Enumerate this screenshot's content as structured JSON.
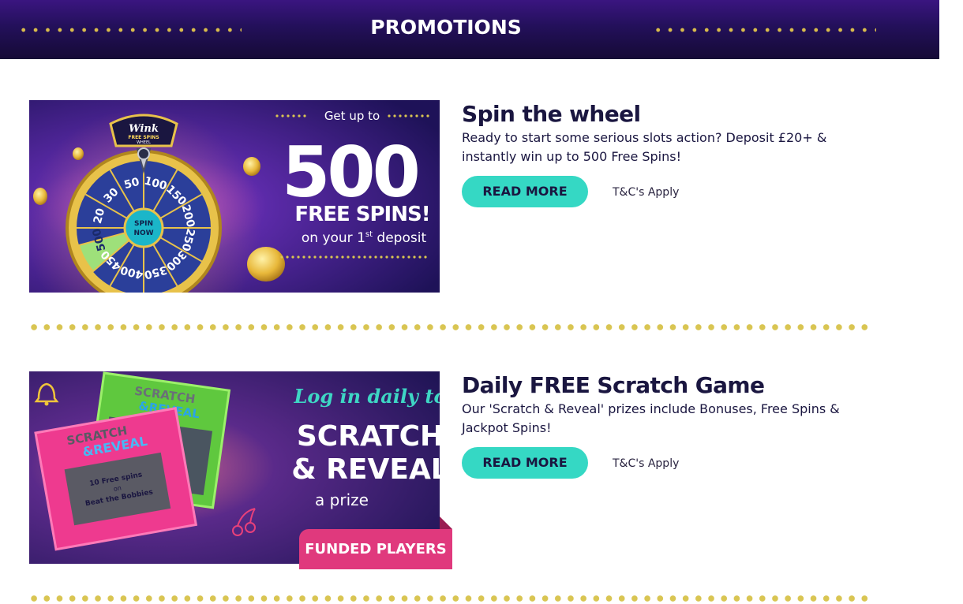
{
  "header": {
    "title": "PROMOTIONS"
  },
  "colors": {
    "header_bg": "#23105a",
    "accent_teal": "#35d8c4",
    "gold_dots": "#d9c552",
    "heading_text": "#1a1640",
    "funded_pink": "#e0397d"
  },
  "promos": [
    {
      "title": "Spin the wheel",
      "description": "Ready to start some serious slots action? Deposit £20+ & instantly win up to 500 Free Spins!",
      "button_label": "READ MORE",
      "terms": "T&C's Apply",
      "banner": {
        "logo_line1": "Wink",
        "logo_line2": "FREE SPINS",
        "logo_line3": "WHEEL",
        "headline_top": "Get up to",
        "headline_number": "500",
        "headline_main": "FREE SPINS!",
        "headline_sub": "on your 1",
        "headline_sub_sup": "st",
        "headline_sub_end": " deposit",
        "wheel_center_1": "SPIN",
        "wheel_center_2": "NOW",
        "wheel_values": [
          "100",
          "150",
          "200",
          "250",
          "300",
          "350",
          "400",
          "450",
          "500",
          "20",
          "30",
          "50"
        ]
      }
    },
    {
      "title": "Daily FREE Scratch Game",
      "description": "Our 'Scratch & Reveal' prizes include Bonuses, Free Spins & Jackpot Spins!",
      "button_label": "READ MORE",
      "terms": "T&C's Apply",
      "banner": {
        "script_text": "Log in daily to",
        "headline_1": "SCRATCH",
        "headline_2": "& REVEAL",
        "headline_3": "a prize",
        "card_title_1": "SCRATCH",
        "card_title_2": "&REVEAL",
        "card_prize_1": "10 Free spins",
        "card_prize_2": "on",
        "card_prize_3": "Beat the Bobbies",
        "badge": "FUNDED PLAYERS"
      }
    }
  ]
}
